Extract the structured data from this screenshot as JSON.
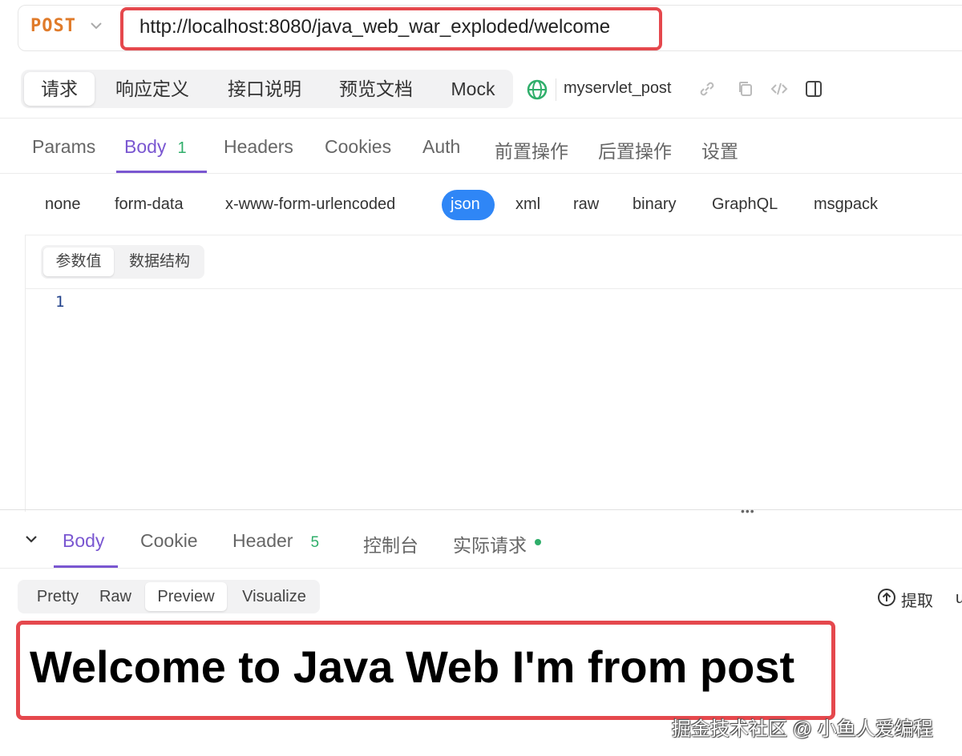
{
  "url_bar": {
    "method": "POST",
    "url": "http://localhost:8080/java_web_war_exploded/welcome"
  },
  "top_tabs": [
    {
      "label": "请求",
      "active": true
    },
    {
      "label": "响应定义",
      "active": false
    },
    {
      "label": "接口说明",
      "active": false
    },
    {
      "label": "预览文档",
      "active": false
    },
    {
      "label": "Mock",
      "active": false
    }
  ],
  "api": {
    "name": "myservlet_post"
  },
  "request_tabs": [
    {
      "label": "Params"
    },
    {
      "label": "Body",
      "count": "1",
      "active": true
    },
    {
      "label": "Headers"
    },
    {
      "label": "Cookies"
    },
    {
      "label": "Auth"
    },
    {
      "label": "前置操作"
    },
    {
      "label": "后置操作"
    },
    {
      "label": "设置"
    }
  ],
  "body_types": [
    "none",
    "form-data",
    "x-www-form-urlencoded",
    "json",
    "xml",
    "raw",
    "binary",
    "GraphQL",
    "msgpack"
  ],
  "body_type_selected": "json",
  "editor": {
    "modes": [
      {
        "label": "参数值",
        "active": true
      },
      {
        "label": "数据结构",
        "active": false
      }
    ],
    "line_number": "1"
  },
  "response": {
    "tabs": [
      {
        "label": "Body",
        "active": true
      },
      {
        "label": "Cookie"
      },
      {
        "label": "Header",
        "count": "5"
      },
      {
        "label": "控制台"
      },
      {
        "label": "实际请求"
      }
    ],
    "views": [
      {
        "label": "Pretty"
      },
      {
        "label": "Raw"
      },
      {
        "label": "Preview",
        "active": true
      },
      {
        "label": "Visualize"
      }
    ],
    "extract_label": "提取",
    "extra_glyph": "u",
    "preview_text": "Welcome to Java Web I'm from post"
  },
  "watermark": "掘金技术社区 @ 小鱼人爱编程",
  "colors": {
    "accent": "#7a57d1",
    "method": "#e07b2a",
    "highlight": "#e5484d",
    "json_pill": "#2f86f6",
    "success": "#2fae6a"
  },
  "icons": [
    "chevron-down-icon",
    "globe-icon",
    "link-icon",
    "copy-icon",
    "code-icon",
    "panel-icon",
    "extract-icon"
  ]
}
